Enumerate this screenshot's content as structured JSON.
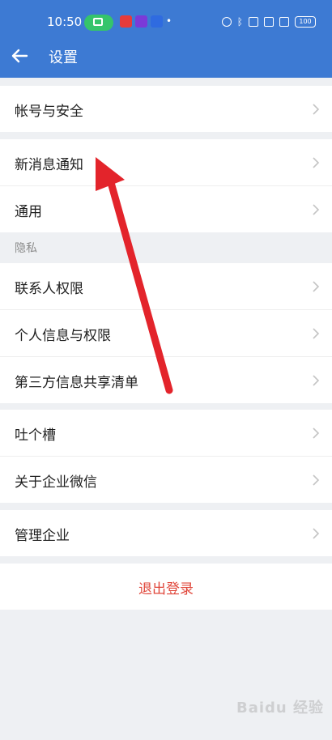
{
  "status_bar": {
    "time": "10:50",
    "battery": "100"
  },
  "header": {
    "title": "设置"
  },
  "groups": {
    "account": "帐号与安全",
    "new_message": "新消息通知",
    "general": "通用",
    "privacy_label": "隐私",
    "contacts_permission": "联系人权限",
    "personal_info": "个人信息与权限",
    "third_party": "第三方信息共享清单",
    "feedback": "吐个槽",
    "about": "关于企业微信",
    "manage": "管理企业",
    "logout": "退出登录"
  },
  "watermark": "Baidu 经验",
  "colors": {
    "header": "#3d7ad3",
    "logout": "#e0463a",
    "arrow": "#e3242b"
  }
}
